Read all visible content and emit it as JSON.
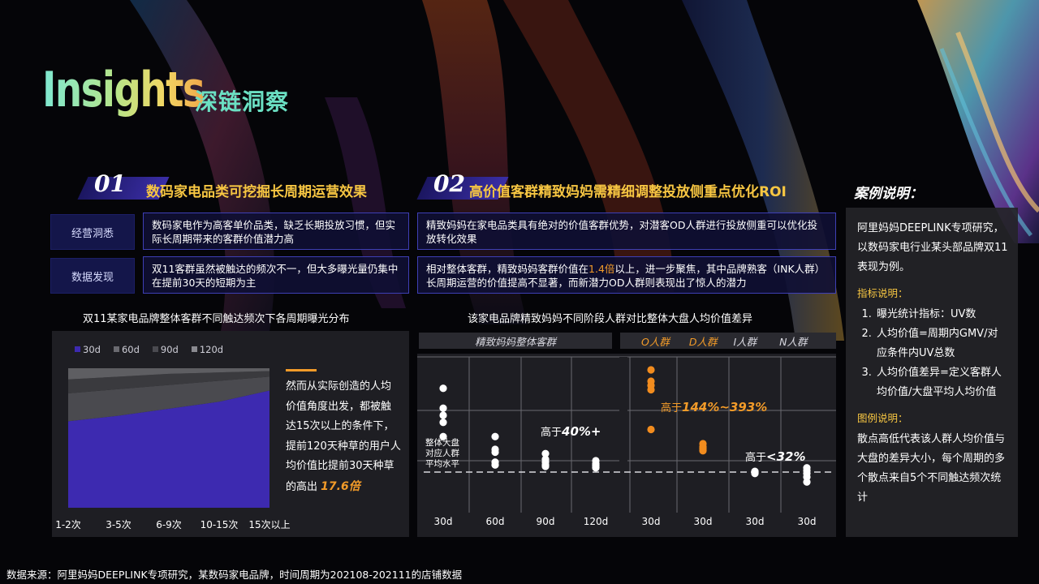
{
  "title": {
    "en": "Insights",
    "cn": "深链洞察"
  },
  "sections": [
    {
      "num": "01",
      "title": "数码家电品类可挖掘长周期运营效果"
    },
    {
      "num": "02",
      "title": "高价值客群精致妈妈需精细调整投放侧重点优化ROI"
    }
  ],
  "rows": [
    {
      "label": "经营洞悉",
      "left": "数码家电作为高客单价品类，缺乏长期投放习惯，但实际长周期带来的客群价值潜力高",
      "right": "精致妈妈在家电品类具有绝对的价值客群优势，对潜客OD人群进行投放侧重可以优化投放转化效果"
    },
    {
      "label": "数据发现",
      "left": "双11客群虽然被触达的频次不一，但大多曝光量仍集中在提前30天的短期为主",
      "right_a": "相对整体客群，精致妈妈客群价值在",
      "right_hl": "1.4倍",
      "right_b": "以上，进一步聚焦，其中品牌熟客（INK人群）长周期运营的价值提高不显著，而新潜力OD人群则表现出了惊人的潜力"
    }
  ],
  "left_chart": {
    "title": "双11某家电品牌整体客群不同触达频次下各周期曝光分布",
    "note_a": "然而从实际创造的人均价值角度出发，都被触达15次以上的条件下，提前120天种草的用户人均价值比提前30天种草的高出",
    "note_big": "17.6倍"
  },
  "right_chart": {
    "title": "该家电品牌精致妈妈不同阶段人群对比整体大盘人均价值差异",
    "group_label": "精致妈妈整体客群",
    "segments": [
      "O人群",
      "D人群",
      "I人群",
      "N人群"
    ],
    "ref_label_1": "整体大盘",
    "ref_label_2": "对应人群",
    "ref_label_3": "平均水平",
    "ann1_pre": "高于",
    "ann1_val": "40%+",
    "ann2_pre": "高于",
    "ann2_val": "144%~393%",
    "ann3_pre": "高于",
    "ann3_val": "<32%",
    "x_labels": [
      "30d",
      "60d",
      "90d",
      "120d",
      "30d",
      "30d",
      "30d",
      "30d"
    ]
  },
  "chart_data": [
    {
      "type": "area",
      "title": "双11某家电品牌整体客群不同触达频次下各周期曝光分布",
      "categories": [
        "1-2次",
        "3-5次",
        "6-9次",
        "10-15次",
        "15次以上"
      ],
      "series": [
        {
          "name": "30d",
          "values": [
            0.62,
            0.66,
            0.71,
            0.76,
            0.84
          ]
        },
        {
          "name": "60d",
          "values": [
            0.2,
            0.19,
            0.17,
            0.15,
            0.1
          ]
        },
        {
          "name": "90d",
          "values": [
            0.1,
            0.09,
            0.08,
            0.06,
            0.04
          ]
        },
        {
          "name": "120d",
          "values": [
            0.08,
            0.06,
            0.04,
            0.03,
            0.02
          ]
        }
      ],
      "ylim": [
        0,
        1
      ],
      "colors": {
        "30d": "#3d2ab0",
        "60d": "#4a4a4f",
        "90d": "#3a3a3e",
        "120d": "#5e5e62"
      },
      "legend": "top-left"
    },
    {
      "type": "scatter",
      "title": "该家电品牌精致妈妈不同阶段人群对比整体大盘人均价值差异",
      "categories": [
        "30d",
        "60d",
        "90d",
        "120d",
        "30d",
        "30d",
        "30d",
        "30d"
      ],
      "groups": [
        "精致妈妈整体客群",
        "精致妈妈整体客群",
        "精致妈妈整体客群",
        "精致妈妈整体客群",
        "O人群",
        "D人群",
        "I人群",
        "N人群"
      ],
      "values": [
        [
          5.9,
          4.5,
          4.0,
          3.5,
          2.5
        ],
        [
          2.5,
          1.6,
          1.4,
          0.7,
          0.5
        ],
        [
          1.3,
          0.9,
          0.7,
          0.5,
          0.4
        ],
        [
          0.8,
          0.6,
          0.5,
          0.4,
          0.3
        ],
        [
          7.2,
          6.4,
          6.1,
          5.8,
          3.0
        ],
        [
          2.0,
          1.8,
          1.7,
          1.6,
          1.5
        ],
        [
          0.05,
          0.0,
          -0.05,
          -0.05,
          -0.1
        ],
        [
          0.3,
          0.1,
          -0.1,
          -0.35,
          -0.7
        ]
      ],
      "reference_line": 0,
      "colors": {
        "whole": "#ffffff",
        "O": "#f28c1e",
        "D": "#f28c1e",
        "I": "#ffffff",
        "N": "#ffffff"
      }
    }
  ],
  "case": {
    "heading": "案例说明：",
    "intro": "阿里妈妈DEEPLINK专项研究，以数码家电行业某头部品牌双11表现为例。",
    "metrics_title": "指标说明：",
    "metrics": [
      "曝光统计指标：UV数",
      "人均价值=周期内GMV/对应条件内UV总数",
      "人均价值差异=定义客群人均价值/大盘平均人均价值"
    ],
    "legend_title": "图例说明：",
    "legend_text": "散点高低代表该人群人均价值与大盘的差异大小，每个周期的多个散点来自5个不同触达频次统计"
  },
  "source": "数据来源：阿里妈妈DEEPLINK专项研究，某数码家电品牌，时间周期为202108-202111的店铺数据"
}
